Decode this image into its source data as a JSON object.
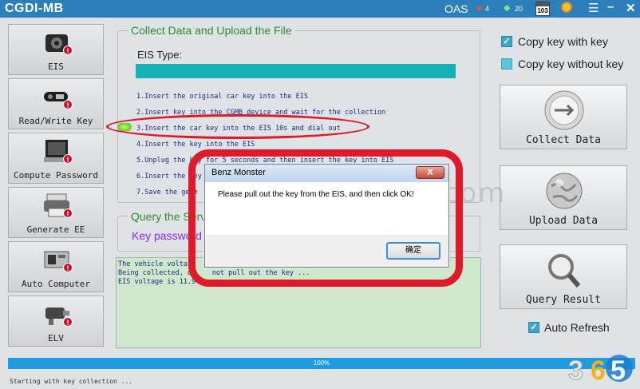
{
  "window": {
    "title": "CGDI-MB",
    "oas": "OAS",
    "heart_count": "4",
    "gem_count": "20",
    "calendar_day": "103",
    "accent": "#2c7fb8"
  },
  "sidebar": {
    "items": [
      {
        "label": "EIS",
        "badge": "!"
      },
      {
        "label": "Read/Write Key",
        "badge": "!"
      },
      {
        "label": "Compute Password",
        "badge": "!"
      },
      {
        "label": "Generate EE",
        "badge": "!"
      },
      {
        "label": "Auto Computer",
        "badge": "!"
      },
      {
        "label": "ELV",
        "badge": "!"
      }
    ]
  },
  "collect": {
    "title": "Collect Data and Upload the File",
    "eis_type_label": "EIS Type:",
    "steps": [
      "1.Insert the original car key into the EIS",
      "2.Insert key into the CGMB device and wait for the collection",
      "3.Insert the car key into the EIS 10s and dial out",
      "4.Insert the key into the EIS",
      "5.Unplug the key for 5 seconds and then insert the key into EIS",
      "6.Insert the key",
      "7.Save the gene"
    ]
  },
  "query": {
    "title": "Query the Serv",
    "key_password_label": "Key password"
  },
  "log": {
    "lines": [
      "The vehicle volta",
      "Being collected, d     not pull out the key ...",
      "EIS voltage is 11.9"
    ]
  },
  "right": {
    "copy_with_key": "Copy key with key",
    "copy_without_key": "Copy key without key",
    "collect_button": "Collect Data",
    "upload_button": "Upload  Data",
    "query_button": "Query Result",
    "auto_refresh": "Auto Refresh"
  },
  "progress": {
    "value": 1.0,
    "label": "100%"
  },
  "status": "Starting with key collection ...",
  "dialog": {
    "title": "Benz Monster",
    "message": "Please pull out the key from the EIS, and then click OK!",
    "ok_label": "确定",
    "close_glyph": "X"
  },
  "watermark": "www.obdii365.com",
  "logo_text": "365"
}
